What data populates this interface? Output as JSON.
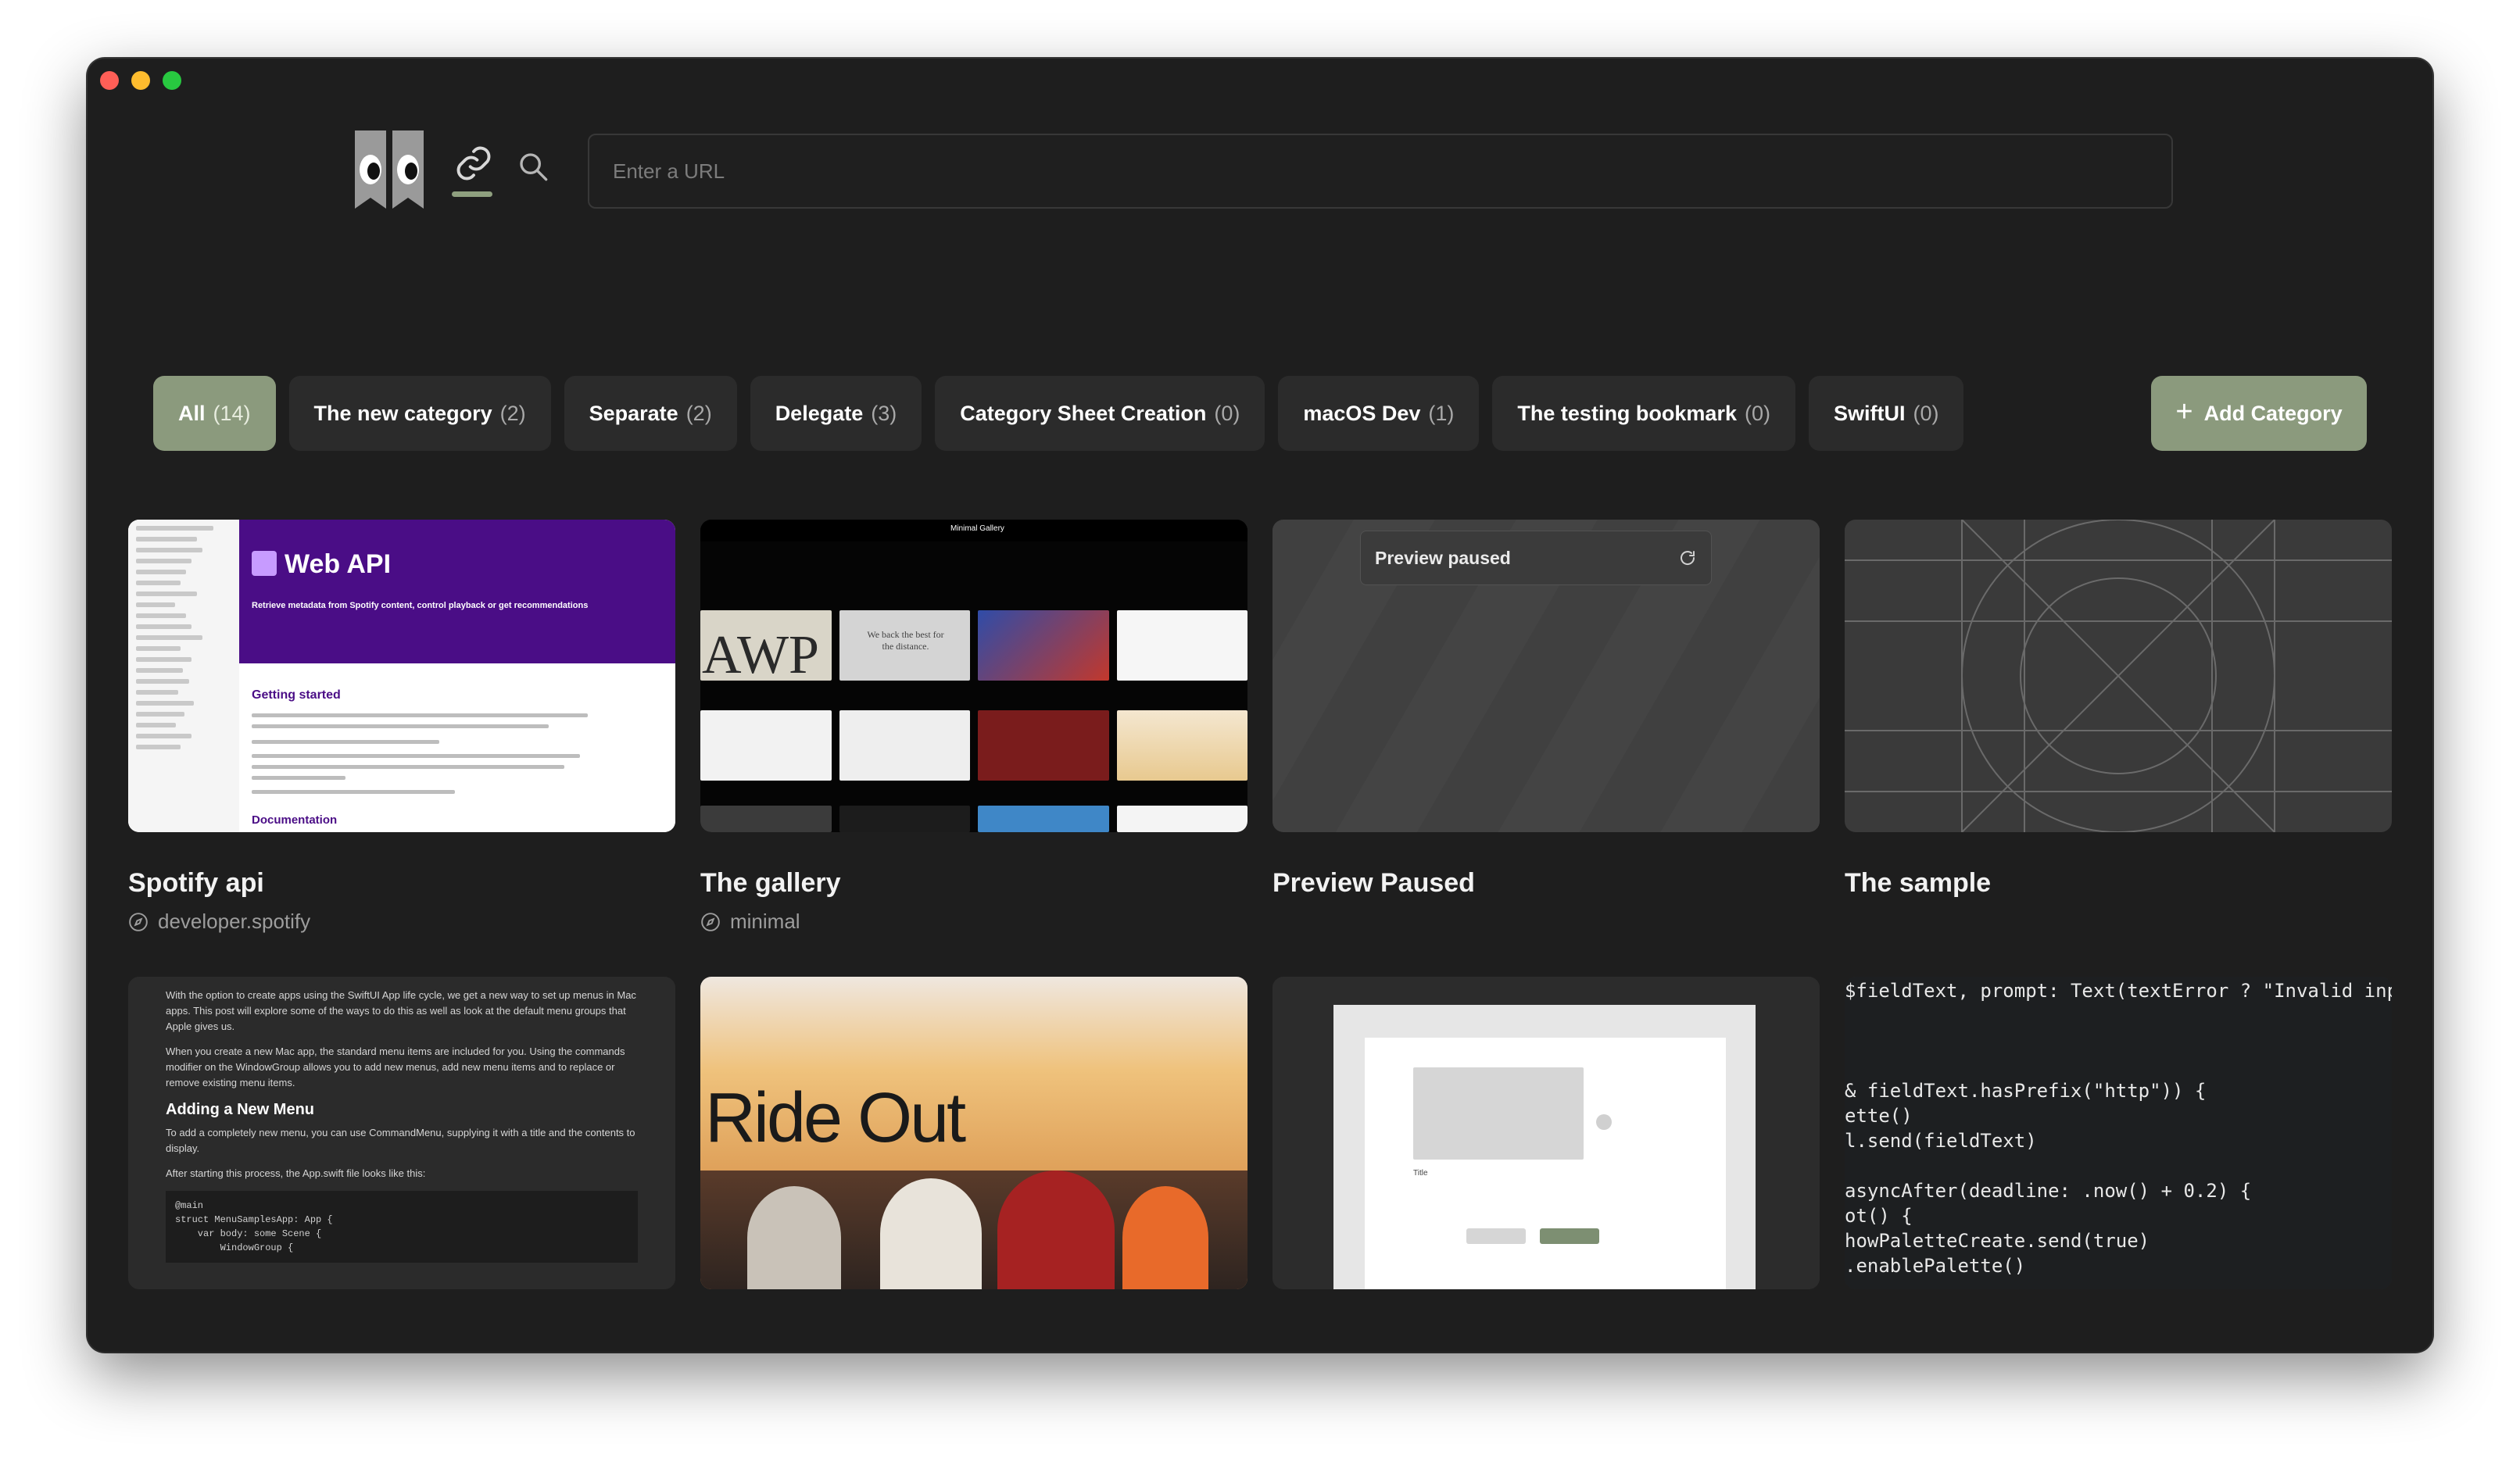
{
  "window": {
    "controls": [
      "close",
      "minimize",
      "zoom"
    ]
  },
  "toolbar": {
    "logo_icon": "eyes-bookmark-logo",
    "link_icon": "link-icon",
    "search_icon": "search-icon",
    "url_placeholder": "Enter a URL"
  },
  "categories": [
    {
      "label": "All",
      "count": "(14)",
      "active": true
    },
    {
      "label": "The new category",
      "count": "(2)"
    },
    {
      "label": "Separate",
      "count": "(2)"
    },
    {
      "label": "Delegate",
      "count": "(3)"
    },
    {
      "label": "Category Sheet Creation",
      "count": "(0)"
    },
    {
      "label": "macOS Dev",
      "count": "(1)"
    },
    {
      "label": "The testing bookmark",
      "count": "(0)"
    },
    {
      "label": "SwiftUI",
      "count": "(0)"
    }
  ],
  "add_category": {
    "icon": "plus-icon",
    "label": "Add Category"
  },
  "bookmarks": [
    {
      "title": "Spotify api",
      "source": "developer.spotify",
      "thumb": {
        "brand": "Web API",
        "headline": "Retrieve metadata from Spotify content, control playback or get recommendations",
        "section": "Getting started",
        "section2": "Documentation"
      }
    },
    {
      "title": "The gallery",
      "source": "minimal",
      "thumb": {
        "bar_title": "Minimal Gallery",
        "big_text": "AWP",
        "tile_text": "We back the best for the distance."
      }
    },
    {
      "title": "Preview Paused",
      "thumb": {
        "pill": "Preview paused"
      }
    },
    {
      "title": "The sample"
    },
    {
      "thumb": {
        "intro": "With the option to create apps using the SwiftUI App life cycle, we get a new way to set up menus in Mac apps. This post will explore some of the ways to do this as well as look at the default menu groups that Apple gives us.",
        "p2": "When you create a new Mac app, the standard menu items are included for you. Using the commands modifier on the WindowGroup allows you to add new menus, add new menu items and to replace or remove existing menu items.",
        "heading": "Adding a New Menu",
        "p3": "To add a completely new menu, you can use CommandMenu, supplying it with a title and the contents to display.",
        "p4": "After starting this process, the App.swift file looks like this:",
        "code": [
          "@main",
          "struct MenuSamplesApp: App {",
          "    var body: some Scene {",
          "        WindowGroup {"
        ]
      }
    },
    {
      "thumb": {
        "headline": "Ride Out"
      }
    },
    {
      "thumb": {
        "frame_label": "Title"
      }
    },
    {
      "thumb": {
        "lines": [
          "$fieldText, prompt: Text(textError ? \"Invalid inpu",
          "",
          "",
          "& fieldText.hasPrefix(\"http\")) {",
          "ette()",
          "l.send(fieldText)",
          "",
          "asyncAfter(deadline: .now() + 0.2) {",
          "ot() {",
          "howPaletteCreate.send(true)",
          ".enablePalette()"
        ]
      }
    }
  ],
  "colors": {
    "accent": "#8b9a7d",
    "window_bg": "#1e1e1e",
    "chip_bg": "#2b2b2b"
  }
}
